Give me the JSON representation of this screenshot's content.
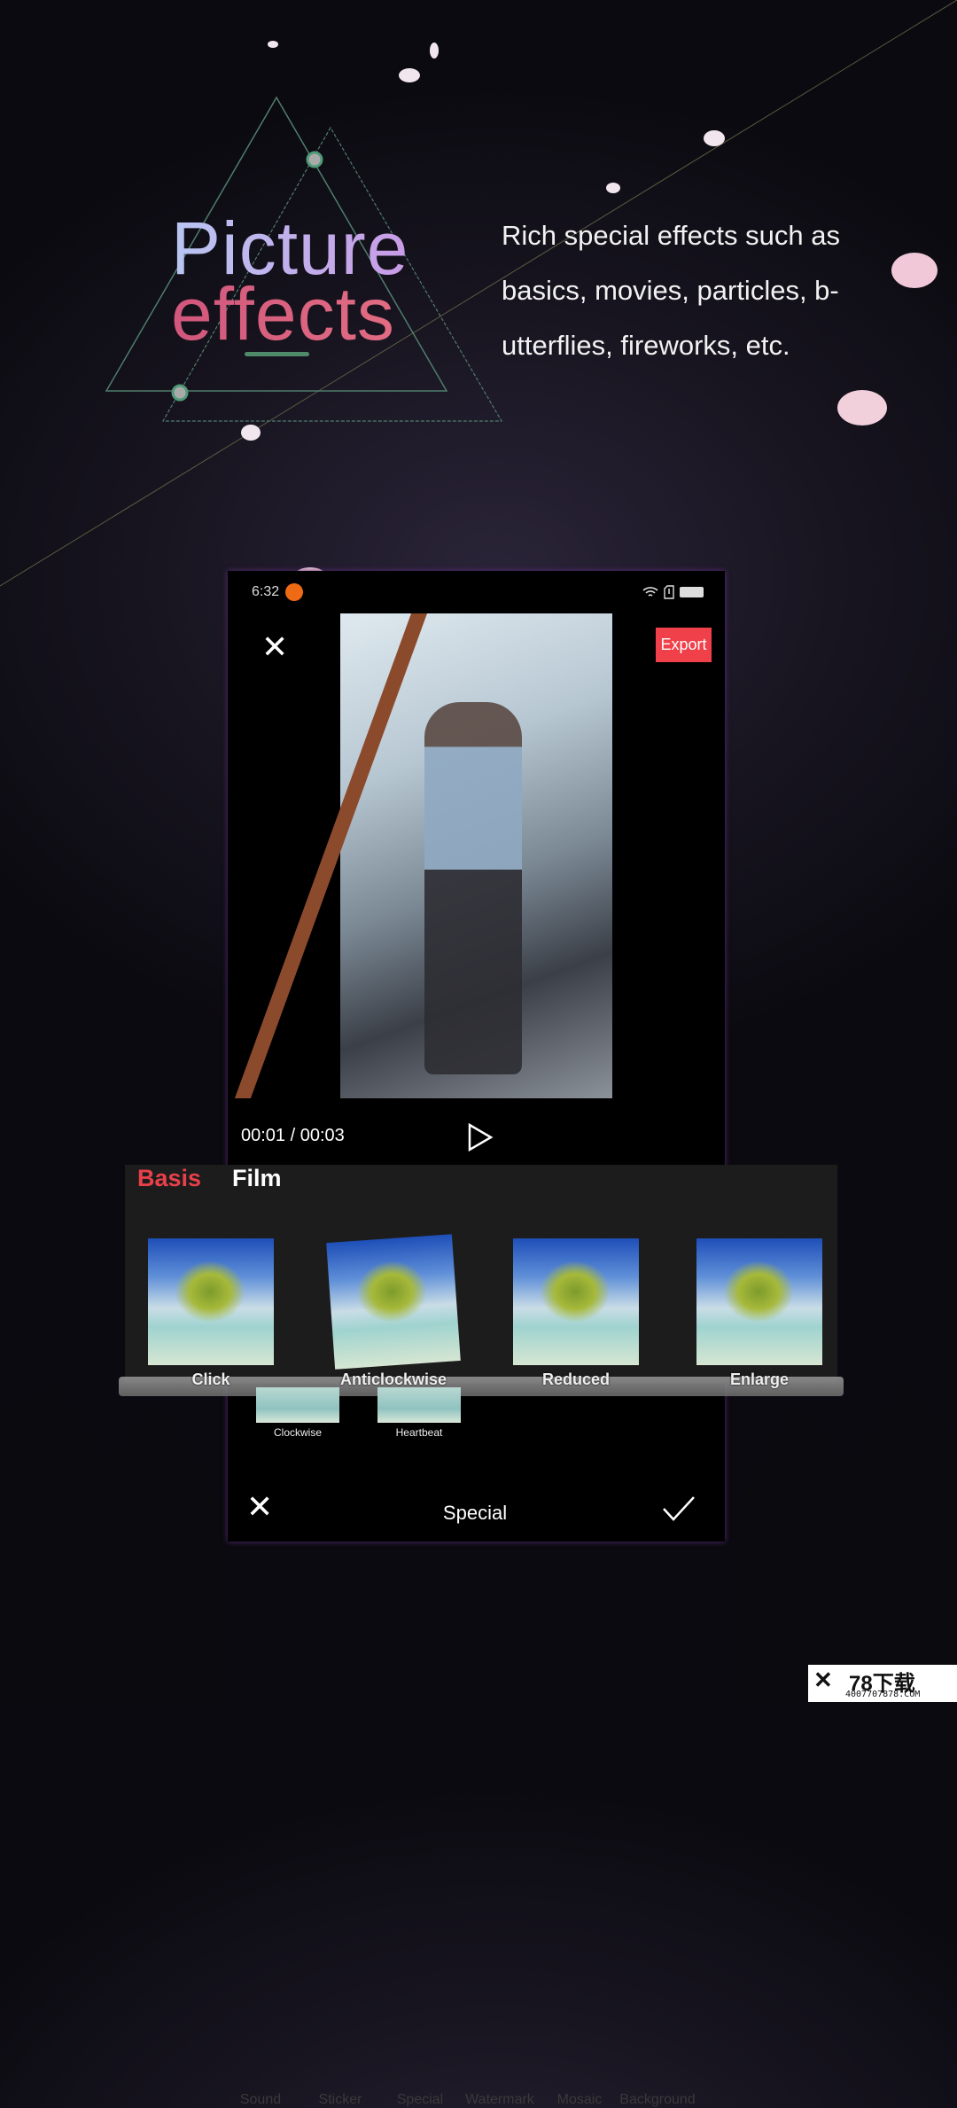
{
  "heading": {
    "line1": "Picture",
    "line2": "effects"
  },
  "description": [
    "Rich special effects such as",
    "basics, movies, particles, b-",
    "utterflies, fireworks, etc."
  ],
  "colors": {
    "accent": "#f0404a",
    "title_top": "#c0b4f0",
    "title_bottom": "#d85a7c",
    "triangle": "#5a8a78"
  },
  "phone": {
    "status": {
      "time": "6:32",
      "icons": [
        "screen-record-icon",
        "wifi-icon",
        "sim-icon",
        "battery-icon"
      ]
    },
    "close_icon": "close-icon",
    "export_label": "Export",
    "playback": {
      "time": "00:01 / 00:03",
      "icon": "play-icon"
    },
    "effects": {
      "tabs": [
        {
          "label": "Basis",
          "active": true
        },
        {
          "label": "Film",
          "active": false
        }
      ],
      "items": [
        "Click",
        "Anticlockwise",
        "Reduced",
        "Enlarge"
      ],
      "small_items": [
        "Clockwise",
        "Heartbeat"
      ]
    },
    "toolbar_faint": [
      "Sound",
      "Sticker",
      "Special",
      "Watermark",
      "Mosaic",
      "Background"
    ],
    "bottom": {
      "title": "Special",
      "cancel_icon": "close-icon",
      "confirm_icon": "check-icon"
    }
  },
  "watermark": {
    "brand": "78下载",
    "site": "4007707878.COM"
  }
}
